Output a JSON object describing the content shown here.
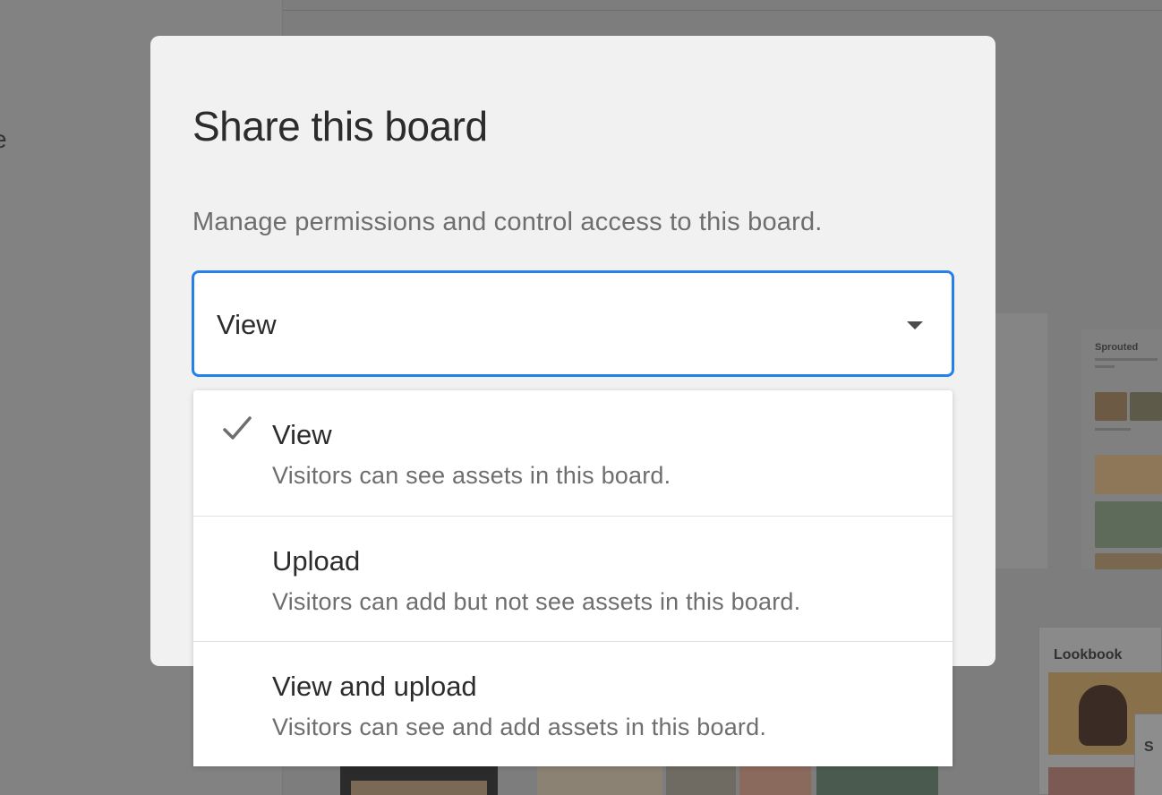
{
  "modal": {
    "title": "Share this board",
    "description": "Manage permissions and control access to this board."
  },
  "permission_select": {
    "selected_value": "View",
    "accent_color": "#2680eb",
    "options": [
      {
        "label": "View",
        "description": "Visitors can see assets in this board.",
        "selected": true
      },
      {
        "label": "Upload",
        "description": "Visitors can add but not see assets in this board.",
        "selected": false
      },
      {
        "label": "View and upload",
        "description": "Visitors can see and add assets in this board.",
        "selected": false
      }
    ]
  },
  "background": {
    "partial_left_text": "e",
    "card_title": "Sprouted",
    "lookbook_title": "Lookbook",
    "lookbook_tab_text": "S"
  }
}
